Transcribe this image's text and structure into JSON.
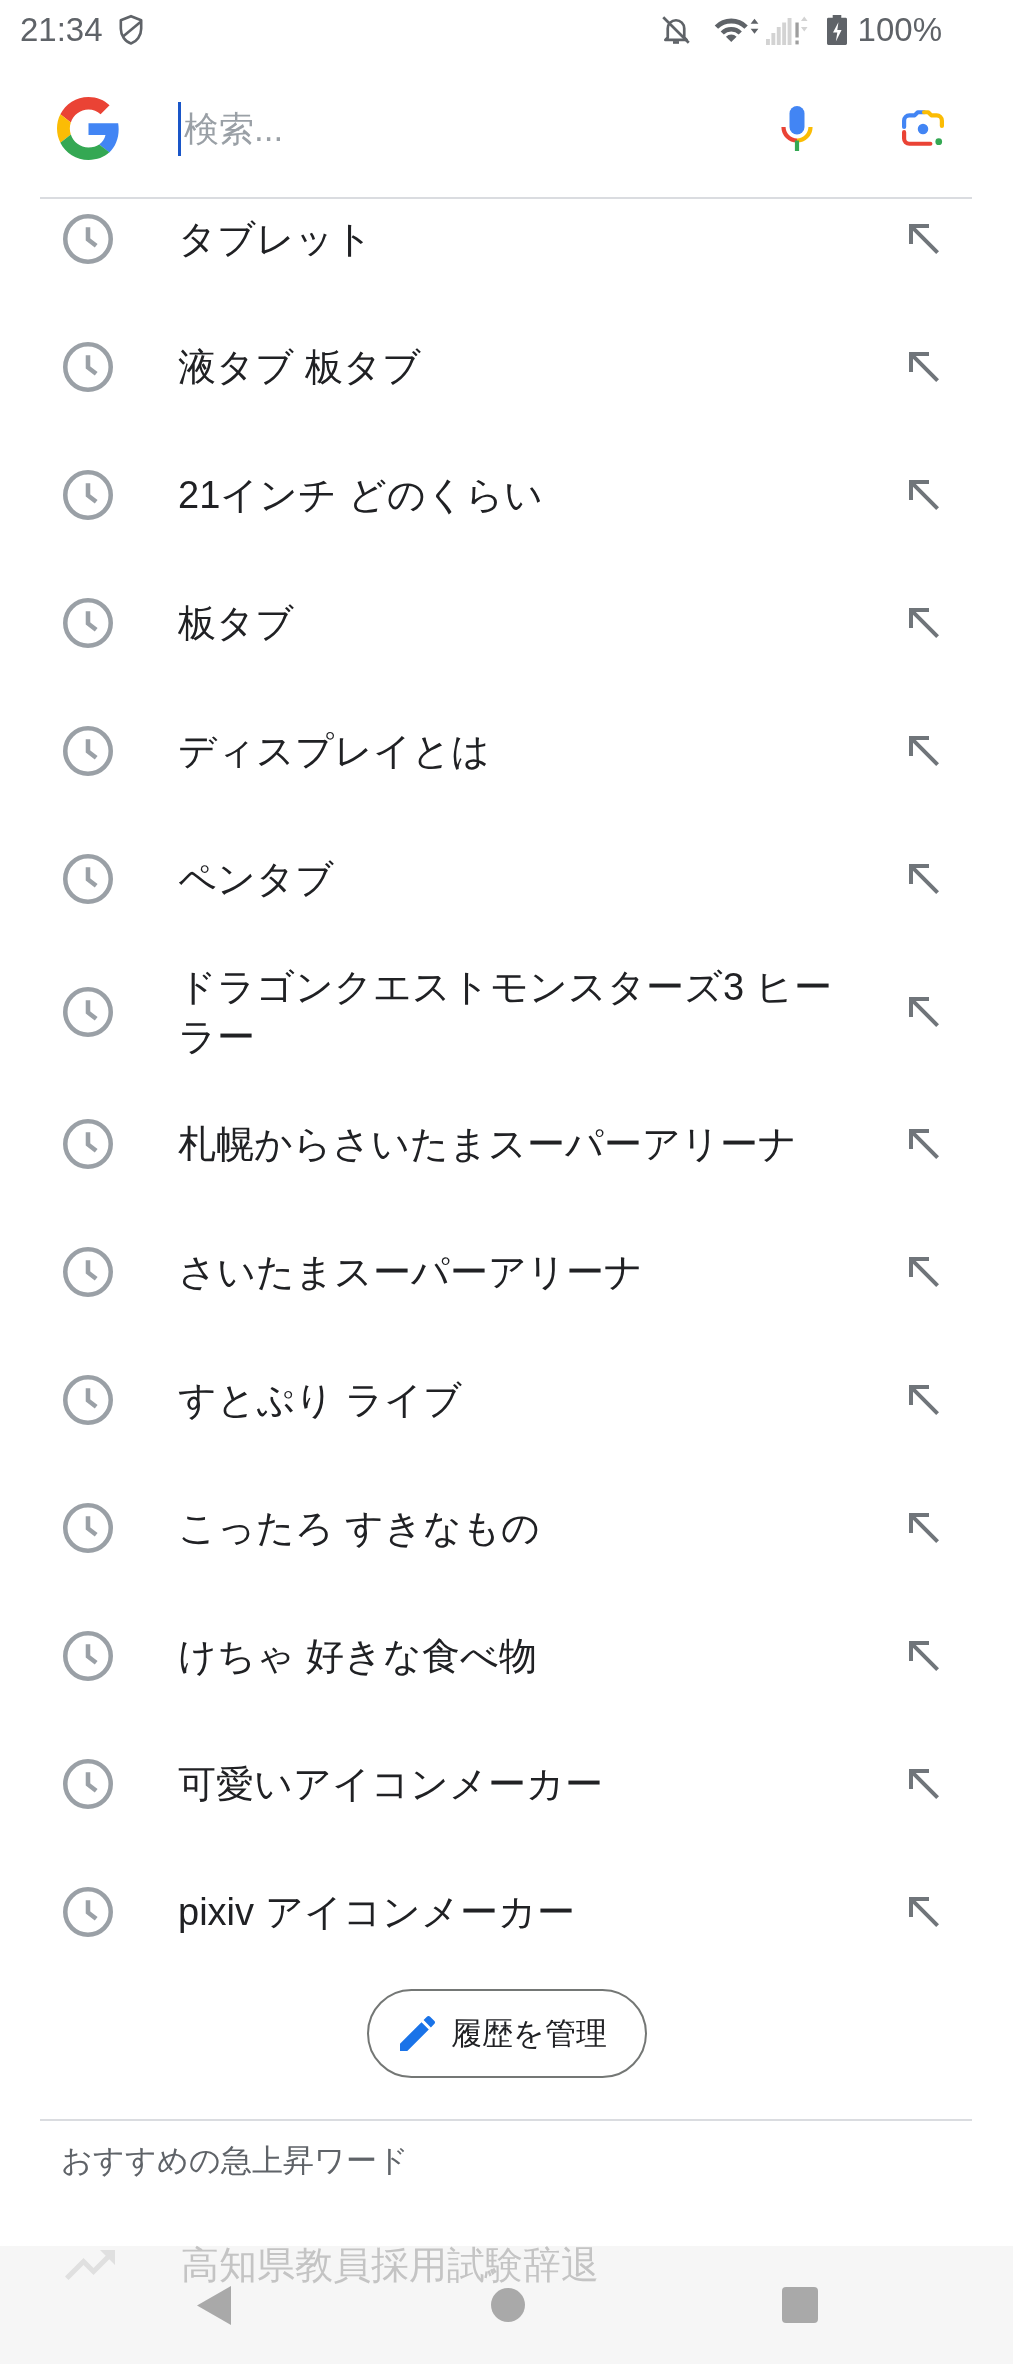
{
  "status_bar": {
    "time": "21:34",
    "battery": "100%"
  },
  "search": {
    "placeholder": "検索...",
    "focused": true
  },
  "history": [
    {
      "query": "タブレット"
    },
    {
      "query": "液タブ 板タブ"
    },
    {
      "query": "21インチ どのくらい"
    },
    {
      "query": "板タブ"
    },
    {
      "query": "ディスプレイとは"
    },
    {
      "query": "ペンタブ"
    },
    {
      "query": "ドラゴンクエストモンスターズ3 ヒーラー"
    },
    {
      "query": "札幌からさいたまスーパーアリーナ"
    },
    {
      "query": "さいたまスーパーアリーナ"
    },
    {
      "query": "すとぷり ライブ"
    },
    {
      "query": "こったろ すきなもの"
    },
    {
      "query": "けちゃ 好きな食べ物"
    },
    {
      "query": "可愛いアイコンメーカー"
    },
    {
      "query": "pixiv アイコンメーカー"
    }
  ],
  "manage_history_button": {
    "label": "履歴を管理"
  },
  "trending": {
    "heading": "おすすめの急上昇ワード",
    "items": [
      {
        "query": "高知県教員採用試験辞退"
      }
    ]
  }
}
